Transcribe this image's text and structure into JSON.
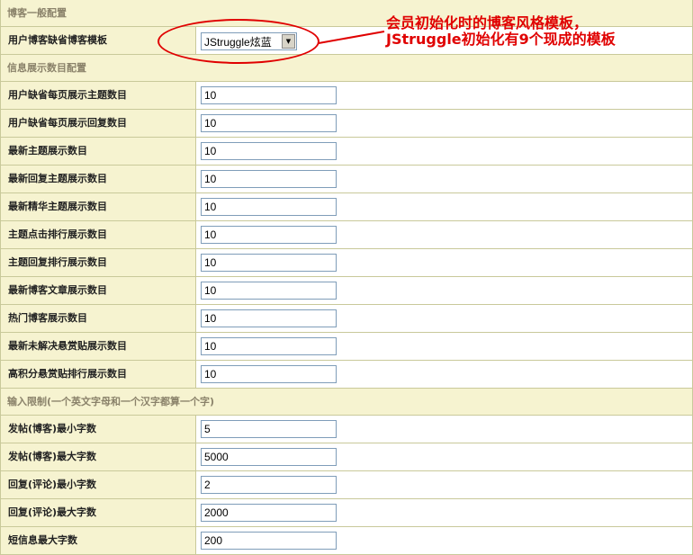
{
  "sections": [
    {
      "title": "博客一般配置",
      "rows": [
        {
          "label": "用户博客缺省博客模板",
          "type": "select",
          "value": "JStruggle炫蓝"
        }
      ]
    },
    {
      "title": "信息展示数目配置",
      "rows": [
        {
          "label": "用户缺省每页展示主题数目",
          "type": "text",
          "value": "10"
        },
        {
          "label": "用户缺省每页展示回复数目",
          "type": "text",
          "value": "10"
        },
        {
          "label": "最新主题展示数目",
          "type": "text",
          "value": "10"
        },
        {
          "label": "最新回复主题展示数目",
          "type": "text",
          "value": "10"
        },
        {
          "label": "最新精华主题展示数目",
          "type": "text",
          "value": "10"
        },
        {
          "label": "主题点击排行展示数目",
          "type": "text",
          "value": "10"
        },
        {
          "label": "主题回复排行展示数目",
          "type": "text",
          "value": "10"
        },
        {
          "label": "最新博客文章展示数目",
          "type": "text",
          "value": "10"
        },
        {
          "label": "热门博客展示数目",
          "type": "text",
          "value": "10"
        },
        {
          "label": "最新未解决悬赏贴展示数目",
          "type": "text",
          "value": "10"
        },
        {
          "label": "高积分悬赏贴排行展示数目",
          "type": "text",
          "value": "10"
        }
      ]
    },
    {
      "title": "输入限制(一个英文字母和一个汉字都算一个字)",
      "rows": [
        {
          "label": "发帖(博客)最小字数",
          "type": "text",
          "value": "5"
        },
        {
          "label": "发帖(博客)最大字数",
          "type": "text",
          "value": "5000"
        },
        {
          "label": "回复(评论)最小字数",
          "type": "text",
          "value": "2"
        },
        {
          "label": "回复(评论)最大字数",
          "type": "text",
          "value": "2000"
        },
        {
          "label": "短信息最大字数",
          "type": "text",
          "value": "200"
        }
      ]
    }
  ],
  "annotation": {
    "text": "会员初始化时的博客风格模板，JStruggle初始化有9个现成的模板",
    "color": "#e00000"
  },
  "colors": {
    "label_bg": "#f6f3d0",
    "border": "#c9c99a",
    "section_text": "#8a826a"
  },
  "icons": {
    "select_arrow": "dropdown-arrow-icon"
  }
}
